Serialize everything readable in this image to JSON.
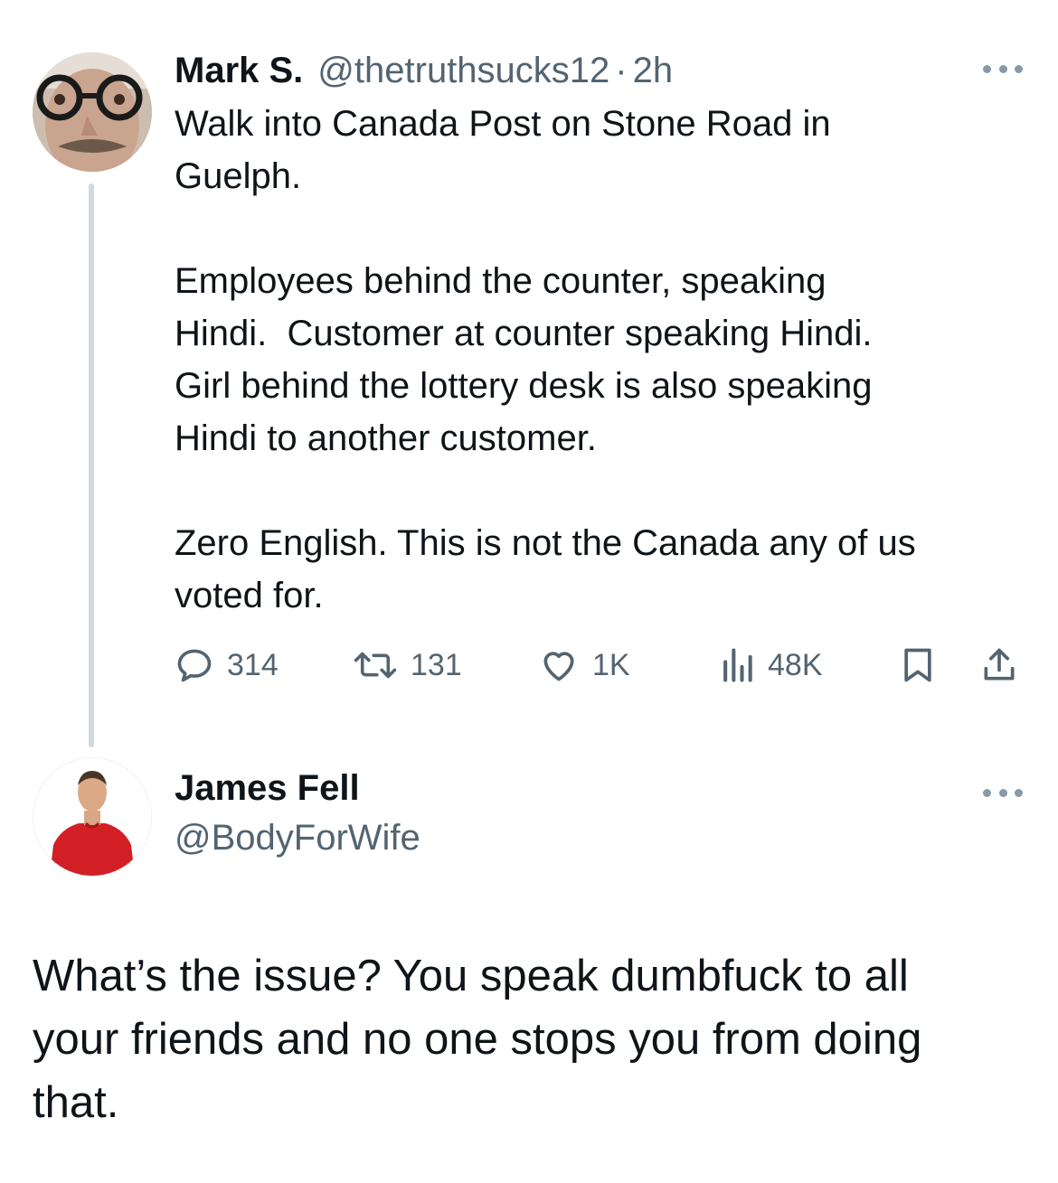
{
  "colors": {
    "text": "#0f1419",
    "secondary": "#536471",
    "thread_line": "#cfd9de",
    "shirt": "#d21f26"
  },
  "tweet1": {
    "author_name": "Mark S.",
    "handle": "@thetruthsucks12",
    "separator": "·",
    "time": "2h",
    "text": "Walk into Canada Post on Stone Road in\nGuelph.\n\nEmployees behind the counter, speaking\nHindi.  Customer at counter speaking Hindi.\nGirl behind the lottery desk is also speaking\nHindi to another customer.\n\nZero English. This is not the Canada any of us\nvoted for.",
    "actions": {
      "replies": "314",
      "retweets": "131",
      "likes": "1K",
      "views": "48K"
    },
    "icons": [
      "reply-icon",
      "retweet-icon",
      "like-icon",
      "views-icon",
      "bookmark-icon",
      "share-icon",
      "more-icon"
    ]
  },
  "tweet2": {
    "author_name": "James Fell",
    "handle": "@BodyForWife",
    "text": "What’s the issue? You speak dumbfuck to all\nyour friends and no one stops you from doing\nthat.",
    "icons": [
      "more-icon"
    ]
  }
}
